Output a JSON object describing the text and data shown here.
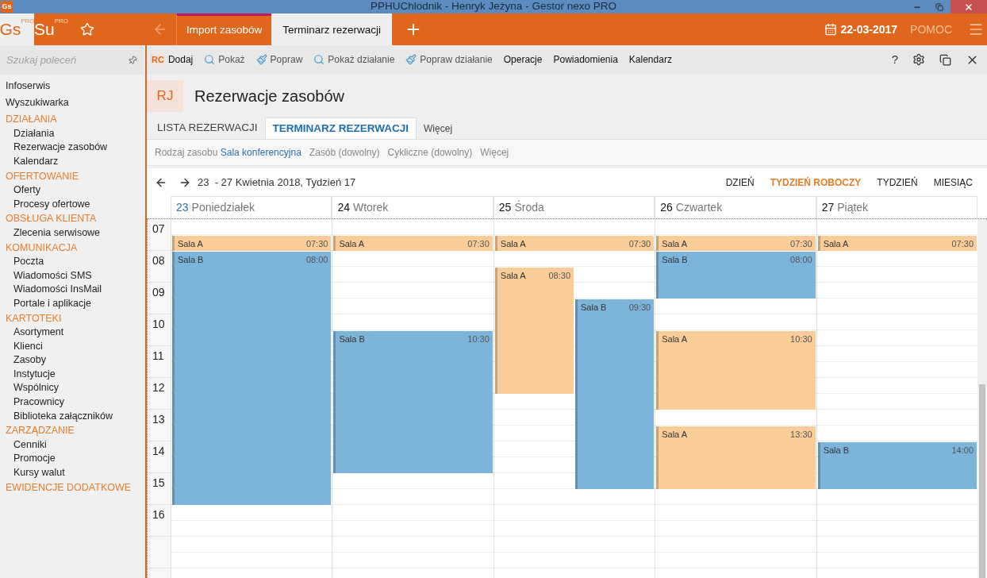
{
  "window": {
    "icon": "Gs",
    "title": "PPHUChlodnik - Henryk Jeżyna - Gestor nexo PRO"
  },
  "app_bar": {
    "logos": [
      {
        "text": "Gs",
        "sup": "PRO",
        "selected": true
      },
      {
        "text": "Su",
        "sup": "PRO",
        "selected": false
      }
    ],
    "tabs": [
      {
        "label": "Import zasobów",
        "selected": false
      },
      {
        "label": "Terminarz rezerwacji",
        "selected": true
      }
    ],
    "date": "22-03-2017",
    "help": "POMOC"
  },
  "sidebar": {
    "search": {
      "placeholder": "Szukaj poleceń"
    },
    "items": [
      {
        "kind": "link",
        "label": "Infoserwis"
      },
      {
        "kind": "link",
        "label": "Wyszukiwarka"
      },
      {
        "kind": "section",
        "label": "DZIAŁANIA",
        "children": [
          {
            "label": "Działania"
          },
          {
            "label": "Rezerwacje zasobów"
          },
          {
            "label": "Kalendarz"
          }
        ]
      },
      {
        "kind": "section",
        "label": "OFERTOWANIE",
        "children": [
          {
            "label": "Oferty"
          },
          {
            "label": "Procesy ofertowe"
          }
        ]
      },
      {
        "kind": "section",
        "label": "OBSŁUGA KLIENTA",
        "children": [
          {
            "label": "Zlecenia serwisowe"
          }
        ]
      },
      {
        "kind": "section",
        "label": "KOMUNIKACJA",
        "children": [
          {
            "label": "Poczta"
          },
          {
            "label": "Wiadomości SMS"
          },
          {
            "label": "Wiadomości InsMail"
          },
          {
            "label": "Portale i aplikacje"
          }
        ]
      },
      {
        "kind": "section",
        "label": "KARTOTEKI",
        "children": [
          {
            "label": "Asortyment"
          },
          {
            "label": "Klienci"
          },
          {
            "label": "Zasoby"
          },
          {
            "label": "Instytucje"
          },
          {
            "label": "Wspólnicy"
          },
          {
            "label": "Pracownicy"
          },
          {
            "label": "Biblioteka załączników"
          }
        ]
      },
      {
        "kind": "section",
        "label": "ZARZĄDZANIE",
        "children": [
          {
            "label": "Cenniki"
          },
          {
            "label": "Promocje"
          },
          {
            "label": "Kursy walut"
          }
        ]
      },
      {
        "kind": "section",
        "label": "EWIDENCJE DODATKOWE"
      }
    ]
  },
  "toolbar": {
    "items": [
      {
        "kind": "badge",
        "badge": "RC",
        "label": "Dodaj",
        "dim": false
      },
      {
        "kind": "search",
        "label": "Pokaż",
        "dim": true
      },
      {
        "kind": "brush",
        "label": "Popraw",
        "dim": true
      },
      {
        "kind": "search",
        "label": "Pokaż działanie",
        "dim": true
      },
      {
        "kind": "brush",
        "label": "Popraw działanie",
        "dim": true
      },
      {
        "kind": "plain",
        "label": "Operacje",
        "dim": false
      },
      {
        "kind": "plain",
        "label": "Powiadomienia",
        "dim": false
      },
      {
        "kind": "plain",
        "label": "Kalendarz",
        "dim": false
      }
    ],
    "help": "?"
  },
  "header": {
    "badge": "RJ",
    "title": "Rezerwacje zasobów"
  },
  "tabs": [
    {
      "label": "LISTA REZERWACJI",
      "selected": false,
      "kind": "tab"
    },
    {
      "label": "TERMINARZ REZERWACJI",
      "selected": true,
      "kind": "tab"
    },
    {
      "label": "Więcej",
      "selected": false,
      "kind": "more"
    }
  ],
  "filters": [
    {
      "label": "Rodzaj zasobu",
      "value": "Sala konferencyjna"
    },
    {
      "label": "Zasób (dowolny)"
    },
    {
      "label": "Cykliczne (dowolny)"
    },
    {
      "label": "Więcej"
    }
  ],
  "calendar": {
    "range": "23  - 27 Kwietnia 2018, Tydzień 17",
    "views": [
      {
        "label": "DZIEŃ",
        "selected": false
      },
      {
        "label": "TYDZIEŃ ROBOCZY",
        "selected": true
      },
      {
        "label": "TYDZIEŃ",
        "selected": false
      },
      {
        "label": "MIESIĄC",
        "selected": false
      }
    ],
    "hours": [
      "07",
      "08",
      "09",
      "10",
      "11",
      "12",
      "13",
      "14",
      "15",
      "16"
    ],
    "days": [
      {
        "number": "23",
        "name": "Poniedziałek",
        "today": true,
        "events": [
          {
            "title": "Sala A",
            "start": "07:30",
            "color": "#f9cc98"
          },
          {
            "title": "Sala B",
            "start": "08:00",
            "color": "#7db4da"
          }
        ]
      },
      {
        "number": "24",
        "name": "Wtorek",
        "today": false,
        "events": [
          {
            "title": "Sala A",
            "start": "07:30",
            "color": "#f9cc98"
          },
          {
            "title": "Sala B",
            "start": "10:30",
            "color": "#7db4da"
          }
        ]
      },
      {
        "number": "25",
        "name": "Środa",
        "today": false,
        "events": [
          {
            "title": "Sala A",
            "start": "07:30",
            "color": "#f9cc98"
          },
          {
            "title": "Sala A",
            "start": "08:30",
            "color": "#f9cc98"
          },
          {
            "title": "Sala B",
            "start": "09:30",
            "color": "#7db4da"
          }
        ]
      },
      {
        "number": "26",
        "name": "Czwartek",
        "today": false,
        "events": [
          {
            "title": "Sala A",
            "start": "07:30",
            "color": "#f9cc98"
          },
          {
            "title": "Sala B",
            "start": "08:00",
            "color": "#7db4da"
          },
          {
            "title": "Sala A",
            "start": "10:30",
            "color": "#f9cc98"
          },
          {
            "title": "Sala A",
            "start": "13:30",
            "color": "#f9cc98"
          }
        ]
      },
      {
        "number": "27",
        "name": "Piątek",
        "today": false,
        "events": [
          {
            "title": "Sala A",
            "start": "07:30",
            "color": "#f9cc98"
          },
          {
            "title": "Sala B",
            "start": "14:00",
            "color": "#7db4da"
          }
        ]
      }
    ]
  }
}
